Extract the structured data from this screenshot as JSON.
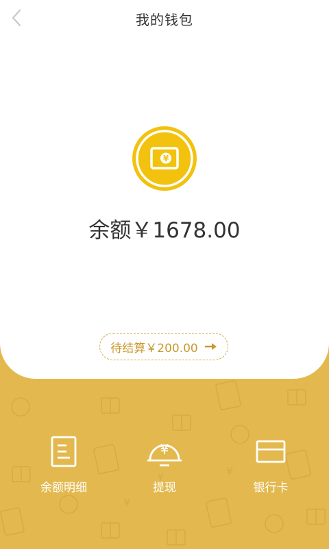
{
  "header": {
    "title": "我的钱包",
    "back_icon": "chevron-left-icon"
  },
  "wallet": {
    "icon": "wallet-icon",
    "accent_color": "#F2C20F",
    "balance_text": "余额￥1678.00"
  },
  "pending": {
    "text": "待结算￥200.00",
    "icon": "arrow-right-icon",
    "color": "#C9992E"
  },
  "actions": [
    {
      "label": "余额明细",
      "icon": "document-list-icon"
    },
    {
      "label": "提现",
      "icon": "yen-coin-icon"
    },
    {
      "label": "银行卡",
      "icon": "card-icon"
    }
  ],
  "colors": {
    "background": "#E3B94F",
    "card": "#FFFFFF"
  }
}
